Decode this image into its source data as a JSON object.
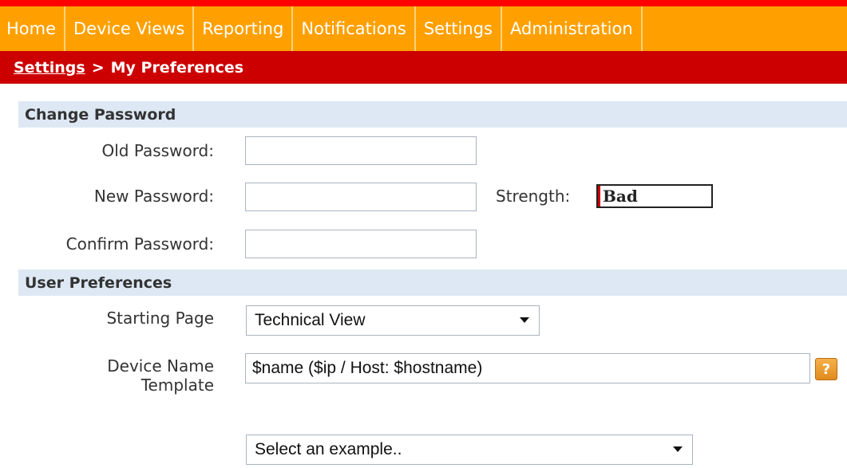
{
  "nav": {
    "items": [
      {
        "label": "Home"
      },
      {
        "label": "Device Views"
      },
      {
        "label": "Reporting"
      },
      {
        "label": "Notifications"
      },
      {
        "label": "Settings"
      },
      {
        "label": "Administration"
      }
    ]
  },
  "breadcrumb": {
    "link": "Settings",
    "separator": ">",
    "current": "My Preferences"
  },
  "change_password": {
    "header": "Change Password",
    "old_label": "Old Password:",
    "new_label": "New Password:",
    "confirm_label": "Confirm Password:",
    "old_value": "",
    "new_value": "",
    "confirm_value": "",
    "strength_label": "Strength:",
    "strength_value": "Bad"
  },
  "user_preferences": {
    "header": "User Preferences",
    "starting_page_label": "Starting Page",
    "starting_page_value": "Technical View",
    "device_name_label_1": "Device Name",
    "device_name_label_2": "Template",
    "device_name_value": "$name ($ip / Host: $hostname)",
    "help_icon": "?",
    "example_select_value": "Select an example.."
  },
  "colors": {
    "nav_bg": "#ffa000",
    "breadcrumb_bg": "#cc0000",
    "section_header_bg": "#dde8f4",
    "strength_bad": "#cc0000"
  }
}
